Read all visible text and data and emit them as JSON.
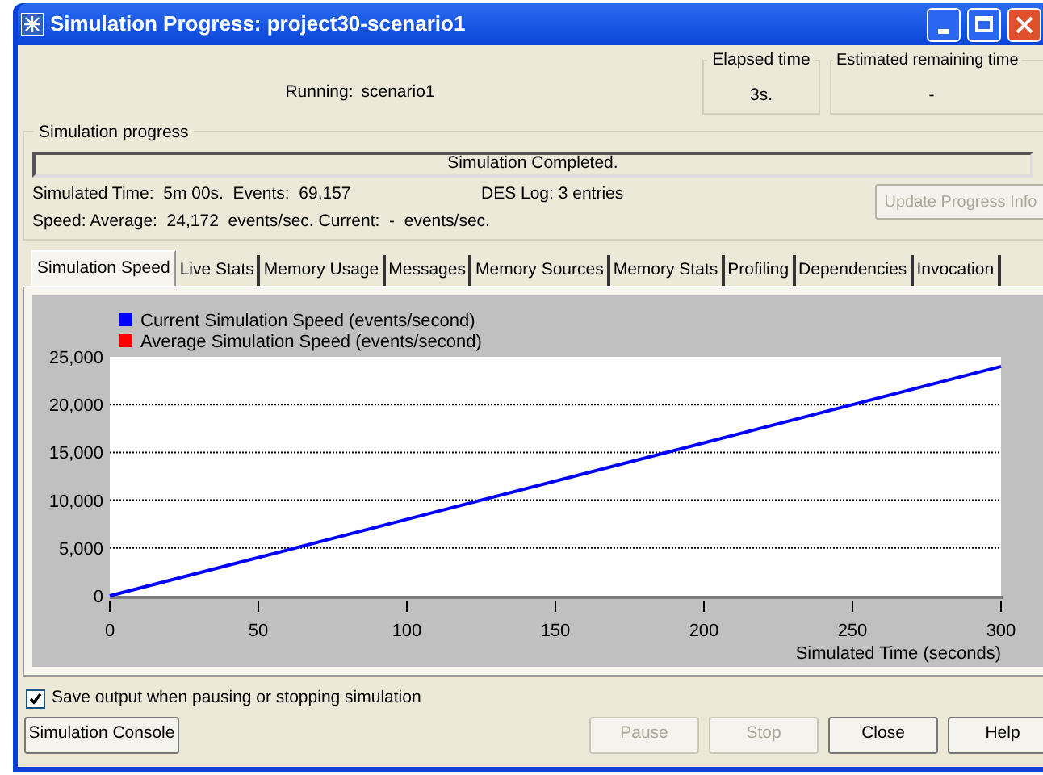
{
  "window": {
    "title": "Simulation Progress: project30-scenario1"
  },
  "running": {
    "label": "Running:",
    "value": "scenario1"
  },
  "elapsed_time": {
    "label": "Elapsed time",
    "value": "3s."
  },
  "estimated_remaining_time": {
    "label": "Estimated remaining time",
    "value": "-"
  },
  "simulation_progress": {
    "label": "Simulation progress",
    "status": "Simulation Completed.",
    "simulated_time": "Simulated Time:  5m 00s.  Events:  69,157",
    "des_log": "DES Log: 3 entries",
    "speed": "Speed: Average:  24,172  events/sec. Current:  -  events/sec.",
    "update_button": {
      "label": "Update Progress Info",
      "disabled": true
    }
  },
  "tabs": [
    {
      "label": "Simulation Speed",
      "selected": true
    },
    {
      "label": "Live Stats",
      "selected": false
    },
    {
      "label": "Memory Usage",
      "selected": false
    },
    {
      "label": "Messages",
      "selected": false
    },
    {
      "label": "Memory Sources",
      "selected": false
    },
    {
      "label": "Memory Stats",
      "selected": false
    },
    {
      "label": "Profiling",
      "selected": false
    },
    {
      "label": "Dependencies",
      "selected": false
    },
    {
      "label": "Invocation",
      "selected": false
    }
  ],
  "chart": {
    "chart_data": {
      "type": "line",
      "xlabel": "Simulated Time (seconds)",
      "x": [
        0,
        300
      ],
      "series": [
        {
          "name": "Current Simulation Speed (events/second)",
          "color": "#0000ff",
          "values": [
            0,
            24000
          ]
        },
        {
          "name": "Average Simulation Speed (events/second)",
          "color": "#ff0000",
          "values": [
            null,
            null
          ]
        }
      ],
      "grid": true,
      "xlim": [
        0,
        300
      ],
      "ylim": [
        0,
        25000
      ],
      "xticks": [
        0,
        50,
        100,
        150,
        200,
        250,
        300
      ],
      "yticks": [
        {
          "value": 0,
          "label": "0"
        },
        {
          "value": 5000,
          "label": "5,000"
        },
        {
          "value": 10000,
          "label": "10,000"
        },
        {
          "value": 15000,
          "label": "15,000"
        },
        {
          "value": 20000,
          "label": "20,000"
        },
        {
          "value": 25000,
          "label": "25,000"
        }
      ]
    }
  },
  "save_output": {
    "label": "Save output when pausing or stopping simulation",
    "checked": true
  },
  "buttons": [
    {
      "label": "Simulation Console",
      "disabled": false,
      "kind": "left"
    },
    {
      "label": "Pause",
      "disabled": true,
      "kind": "right"
    },
    {
      "label": "Stop",
      "disabled": true,
      "kind": "right"
    },
    {
      "label": "Close",
      "disabled": false,
      "kind": "right"
    },
    {
      "label": "Help",
      "disabled": false,
      "kind": "right"
    }
  ]
}
